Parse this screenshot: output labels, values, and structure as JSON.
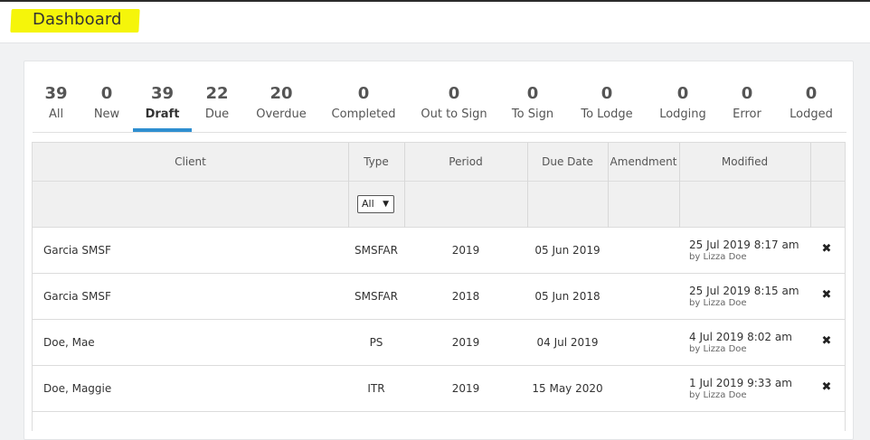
{
  "header": {
    "title": "Dashboard"
  },
  "tabs": [
    {
      "count": "39",
      "label": "All"
    },
    {
      "count": "0",
      "label": "New"
    },
    {
      "count": "39",
      "label": "Draft",
      "active": true
    },
    {
      "count": "22",
      "label": "Due"
    },
    {
      "count": "20",
      "label": "Overdue"
    },
    {
      "count": "0",
      "label": "Completed"
    },
    {
      "count": "0",
      "label": "Out to Sign"
    },
    {
      "count": "0",
      "label": "To Sign"
    },
    {
      "count": "0",
      "label": "To Lodge"
    },
    {
      "count": "0",
      "label": "Lodging"
    },
    {
      "count": "0",
      "label": "Error"
    },
    {
      "count": "0",
      "label": "Lodged"
    }
  ],
  "table": {
    "columns": [
      "Client",
      "Type",
      "Period",
      "Due Date",
      "Amendment",
      "Modified"
    ],
    "type_filter": {
      "selected": "All",
      "arrow": "▼"
    },
    "delete_glyph": "✖",
    "rows": [
      {
        "client": "Garcia SMSF",
        "type": "SMSFAR",
        "period": "2019",
        "due_date": "05 Jun 2019",
        "modified": "25 Jul 2019 8:17 am",
        "modified_by": "by Lizza Doe"
      },
      {
        "client": "Garcia SMSF",
        "type": "SMSFAR",
        "period": "2018",
        "due_date": "05 Jun 2018",
        "modified": "25 Jul 2019 8:15 am",
        "modified_by": "by Lizza Doe"
      },
      {
        "client": "Doe, Mae",
        "type": "PS",
        "period": "2019",
        "due_date": "04 Jul 2019",
        "modified": "4 Jul 2019 8:02 am",
        "modified_by": "by Lizza Doe"
      },
      {
        "client": "Doe, Maggie",
        "type": "ITR",
        "period": "2019",
        "due_date": "15 May 2020",
        "modified": "1 Jul 2019 9:33 am",
        "modified_by": "by Lizza Doe"
      }
    ]
  },
  "colors": {
    "accent": "#2f8fd0",
    "highlight": "#f5f50a"
  }
}
